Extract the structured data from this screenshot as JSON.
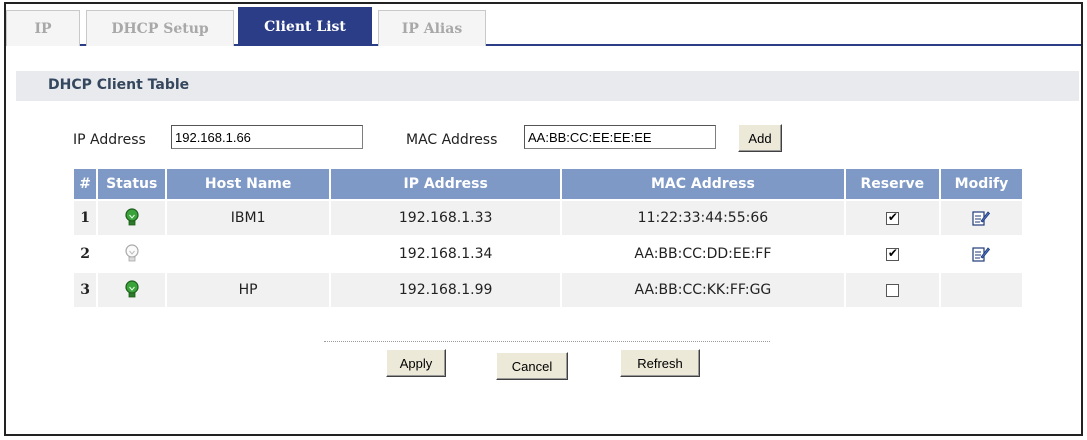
{
  "tabs": [
    {
      "label": "IP",
      "active": false
    },
    {
      "label": "DHCP Setup",
      "active": false
    },
    {
      "label": "Client List",
      "active": true
    },
    {
      "label": "IP Alias",
      "active": false
    }
  ],
  "section_title": "DHCP Client Table",
  "form": {
    "ip_label": "IP Address",
    "ip_value": "192.168.1.66",
    "mac_label": "MAC Address",
    "mac_value": "AA:BB:CC:EE:EE:EE",
    "add_label": "Add"
  },
  "table": {
    "headers": [
      "#",
      "Status",
      "Host Name",
      "IP Address",
      "MAC Address",
      "Reserve",
      "Modify"
    ],
    "rows": [
      {
        "num": "1",
        "status": "active",
        "host": "IBM1",
        "ip": "192.168.1.33",
        "mac": "11:22:33:44:55:66",
        "reserve": true,
        "modify": true
      },
      {
        "num": "2",
        "status": "inactive",
        "host": "",
        "ip": "192.168.1.34",
        "mac": "AA:BB:CC:DD:EE:FF",
        "reserve": true,
        "modify": true
      },
      {
        "num": "3",
        "status": "active",
        "host": "HP",
        "ip": "192.168.1.99",
        "mac": "AA:BB:CC:KK:FF:GG",
        "reserve": false,
        "modify": false
      }
    ]
  },
  "buttons": {
    "apply": "Apply",
    "cancel": "Cancel",
    "refresh": "Refresh"
  },
  "colors": {
    "accent": "#2b3d86",
    "header": "#7f99c6",
    "status_active": "#2e8b2e",
    "status_inactive": "#b8b8b8"
  }
}
